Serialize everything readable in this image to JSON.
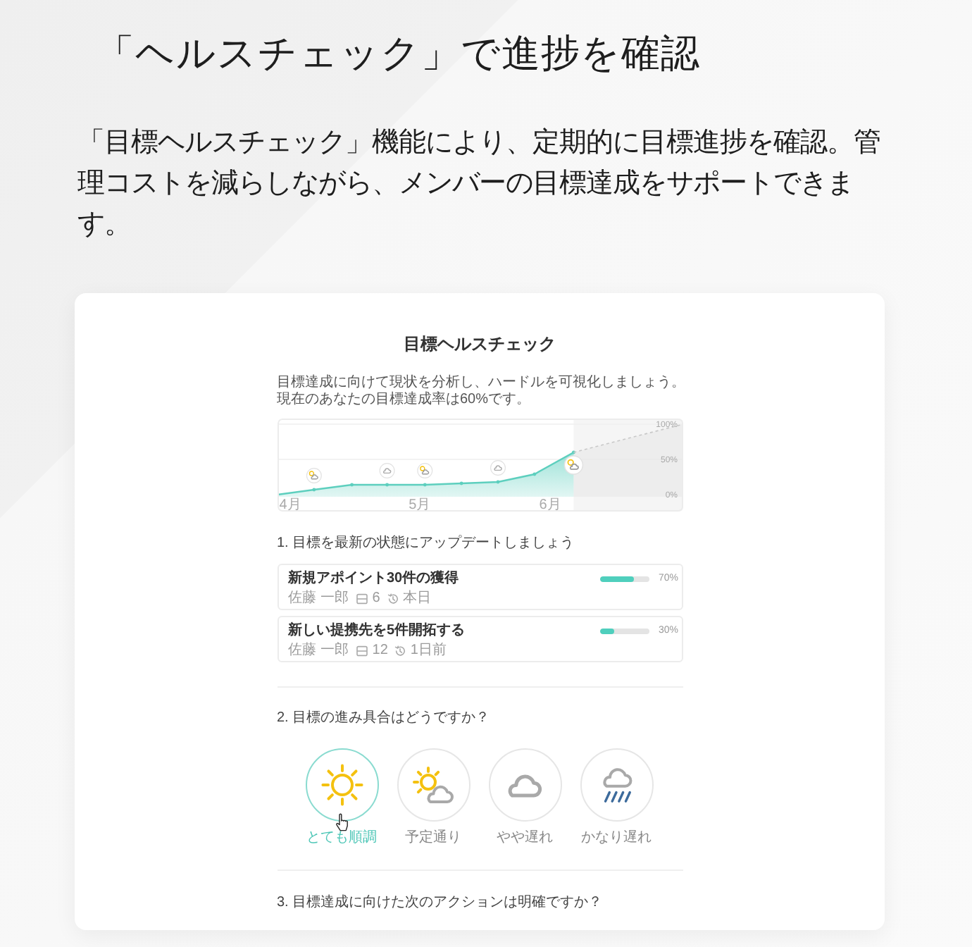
{
  "heading": "「ヘルスチェック」で進捗を確認",
  "description": "「目標ヘルスチェック」機能により、定期的に目標進捗を確認。管理コストを減らしながら、メンバーの目標達成をサポートできます。",
  "card": {
    "title": "目標ヘルスチェック",
    "intro_lines": [
      "目標達成に向けて現状を分析し、ハードルを可視化しましょう。",
      "現在のあなたの目標達成率は60%です。"
    ],
    "chart": {
      "chart_data": {
        "type": "area",
        "x": [
          3.91,
          4.19,
          4.48,
          4.75,
          5.04,
          5.32,
          5.6,
          5.88,
          6.18,
          7.02
        ],
        "xlim": [
          3.91,
          7.02
        ],
        "ylim": [
          0,
          100
        ],
        "xticks": [
          {
            "value": 4,
            "label": "4月"
          },
          {
            "value": 5,
            "label": "5月"
          },
          {
            "value": 6,
            "label": "6月"
          }
        ],
        "yticks": [
          {
            "value": 0,
            "label": "0%"
          },
          {
            "value": 50,
            "label": "50%"
          },
          {
            "value": 100,
            "label": "100%"
          }
        ],
        "series": [
          {
            "color": "#5dcfbe",
            "values": [
              0,
              7,
              14,
              14,
              14,
              16,
              18,
              29,
              60,
              null
            ]
          },
          {
            "color": "#c8c8c8",
            "values": [
              null,
              null,
              null,
              null,
              null,
              null,
              null,
              null,
              60,
              100
            ]
          }
        ]
      },
      "point_markers": [
        {
          "kind": "none"
        },
        {
          "kind": "partly_sunny"
        },
        {
          "kind": "none"
        },
        {
          "kind": "cloudy"
        },
        {
          "kind": "partly_sunny"
        },
        {
          "kind": "none"
        },
        {
          "kind": "cloudy"
        },
        {
          "kind": "none"
        },
        {
          "kind": "partly_sunny"
        }
      ]
    },
    "goal_section": {
      "heading": "1. 目標を最新の状態にアップデートしましょう",
      "goals": [
        {
          "title": "新規アポイント30件の獲得",
          "owner": "佐藤 一郎",
          "count": "6",
          "updated": "本日",
          "level": 0.7,
          "percent": "70%"
        },
        {
          "title": "新しい提携先を5件開拓する",
          "owner": "佐藤 一郎",
          "count": "12",
          "updated": "1日前",
          "level": 0.3,
          "percent": "30%"
        }
      ]
    },
    "progress_question": {
      "heading": "2. 目標の進み具合はどうですか？",
      "options": [
        {
          "label": "とても順調",
          "kind": "sunny",
          "selected": true
        },
        {
          "label": "予定通り",
          "kind": "partly_sunny",
          "selected": false
        },
        {
          "label": "やや遅れ",
          "kind": "cloudy",
          "selected": false
        },
        {
          "label": "かなり遅れ",
          "kind": "rainy",
          "selected": false
        }
      ]
    },
    "action_question": {
      "heading": "3. 目標達成に向けた次のアクションは明確ですか？"
    }
  }
}
